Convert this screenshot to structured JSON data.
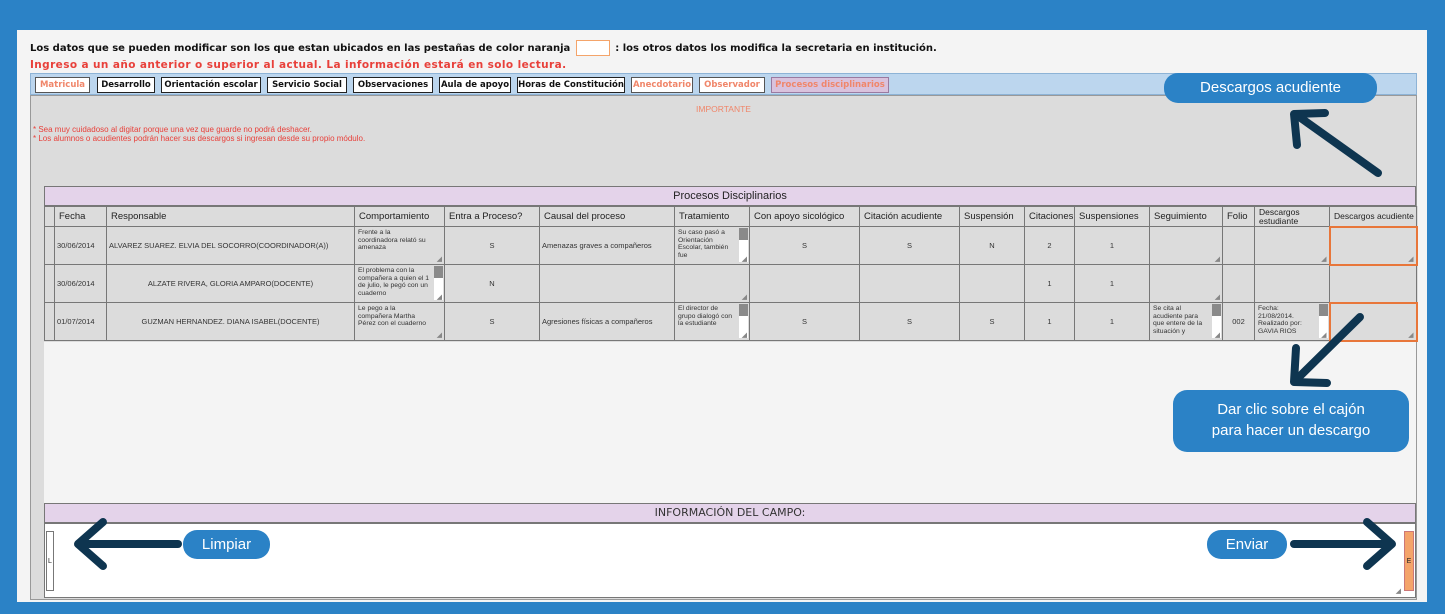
{
  "notices": {
    "line1_before": "Los datos que se pueden modificar son los que estan ubicados en las pestañas de color naranja",
    "line1_after": ": los otros datos los modifica la secretaria en institución.",
    "line2": "Ingreso a un año anterior o superior al actual. La información estará en solo lectura."
  },
  "tabs": [
    {
      "label": "Matricula",
      "type": "orange"
    },
    {
      "label": "Desarrollo",
      "type": "normal"
    },
    {
      "label": "Orientación escolar",
      "type": "normal"
    },
    {
      "label": "Servicio Social",
      "type": "normal"
    },
    {
      "label": "Observaciones",
      "type": "normal"
    },
    {
      "label": "Aula de apoyo",
      "type": "normal"
    },
    {
      "label": "Horas de Constitución",
      "type": "normal"
    },
    {
      "label": "Anecdotario",
      "type": "orange"
    },
    {
      "label": "Observador",
      "type": "orange"
    },
    {
      "label": "Procesos disciplinarios",
      "type": "active"
    }
  ],
  "importante": "IMPORTANTE",
  "warnings": [
    "* Sea muy cuidadoso al digitar porque una vez que guarde no podrá deshacer.",
    "* Los alumnos o acudientes podrán hacer sus descargos si ingresan desde su propio módulo."
  ],
  "table": {
    "title": "Procesos Disciplinarios",
    "columns": [
      "Fecha",
      "Responsable",
      "Comportamiento",
      "Entra a Proceso?",
      "Causal del proceso",
      "Tratamiento",
      "Con apoyo sicológico",
      "Citación acudiente",
      "Suspensión",
      "Citaciones",
      "Suspensiones",
      "Seguimiento",
      "Folio",
      "Descargos estudiante",
      "Descargos acudiente"
    ],
    "rows": [
      {
        "fecha": "30/06/2014",
        "responsable": "ALVAREZ SUAREZ. ELVIA DEL SOCORRO(COORDINADOR(A))",
        "comportamiento": "Frente a la coordinadora relató su amenaza",
        "entra": "S",
        "causal": "Amenazas graves a compañeros",
        "tratamiento": "Su caso pasó a Orientación Escolar, también fue",
        "apoyo": "S",
        "citacion": "S",
        "suspension": "N",
        "citaciones": "2",
        "suspensiones": "1",
        "seguimiento": "",
        "folio": "",
        "desc_estudiante": "",
        "desc_acudiente": ""
      },
      {
        "fecha": "30/06/2014",
        "responsable": "ALZATE RIVERA, GLORIA AMPARO(DOCENTE)",
        "comportamiento": "El problema con la compañera a quien el 1 de julio, le pegó con un cuaderno",
        "entra": "N",
        "causal": "",
        "tratamiento": "",
        "apoyo": "",
        "citacion": "",
        "suspension": "",
        "citaciones": "1",
        "suspensiones": "1",
        "seguimiento": "",
        "folio": "",
        "desc_estudiante": "",
        "desc_acudiente": ""
      },
      {
        "fecha": "01/07/2014",
        "responsable": "GUZMAN HERNANDEZ. DIANA ISABEL(DOCENTE)",
        "comportamiento": "Le pego a la compañera Martha Pérez con el cuaderno",
        "entra": "S",
        "causal": "Agresiones físicas a compañeros",
        "tratamiento": "El director de grupo dialogó con la estudiante",
        "apoyo": "S",
        "citacion": "S",
        "suspension": "S",
        "citaciones": "1",
        "suspensiones": "1",
        "seguimiento": "Se cita al acudiente para que entere de la situación y",
        "folio": "002",
        "desc_estudiante": "Fecha: 21/08/2014. Realizado por: GAVIA RIOS",
        "desc_acudiente": ""
      }
    ]
  },
  "campo": {
    "title": "INFORMACIÓN DEL CAMPO:",
    "limpiar_btn": "L",
    "enviar_btn": "E"
  },
  "callouts": {
    "descargos": "Descargos acudiente",
    "dar_clic_1": "Dar clic sobre el cajón",
    "dar_clic_2": "para hacer un descargo",
    "limpiar": "Limpiar",
    "enviar": "Enviar"
  },
  "colors": {
    "frame": "#2b82c6",
    "orange": "#f0866a",
    "arrow": "#0e3550",
    "header_purple": "#e4d3ea"
  }
}
